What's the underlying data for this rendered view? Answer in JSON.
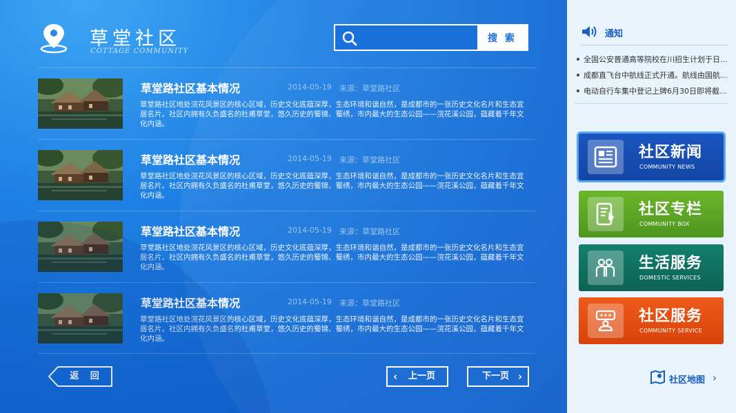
{
  "app": {
    "title": "草堂社区",
    "subtitle": "COTTAGE COMMUNITY"
  },
  "search": {
    "placeholder": "",
    "button_label": "搜 索"
  },
  "articles": [
    {
      "title": "草堂路社区基本情况",
      "date": "2014-05-19",
      "source": "来源：草堂路社区",
      "desc": "草堂路社区地处浣花风景区的核心区域，历史文化底蕴深厚，生态环境和谐自然，是成都市的一张历史文化名片和生态宜居名片。社区内拥有久负盛名的杜甫草堂，悠久历史的蜀锦、蜀绣，市内最大的生态公园——浣花溪公园，蕴藏着千年文化内涵。"
    },
    {
      "title": "草堂路社区基本情况",
      "date": "2014-05-19",
      "source": "来源：草堂路社区",
      "desc": "草堂路社区地处浣花风景区的核心区域，历史文化底蕴深厚，生态环境和谐自然，是成都市的一张历史文化名片和生态宜居名片。社区内拥有久负盛名的杜甫草堂，悠久历史的蜀锦、蜀绣，市内最大的生态公园——浣花溪公园，蕴藏着千年文化内涵。"
    },
    {
      "title": "草堂路社区基本情况",
      "date": "2014-05-19",
      "source": "来源：草堂路社区",
      "desc": "草堂路社区地处浣花风景区的核心区域，历史文化底蕴深厚，生态环境和谐自然，是成都市的一张历史文化名片和生态宜居名片。社区内拥有久负盛名的杜甫草堂，悠久历史的蜀锦、蜀绣，市内最大的生态公园——浣花溪公园，蕴藏着千年文化内涵。"
    },
    {
      "title": "草堂路社区基本情况",
      "date": "2014-05-19",
      "source": "来源：草堂路社区",
      "desc": "草堂路社区地处浣花风景区的核心区域，历史文化底蕴深厚，生态环境和谐自然，是成都市的一张历史文化名片和生态宜居名片。社区内拥有久负盛名的杜甫草堂，悠久历史的蜀锦、蜀绣，市内最大的生态公园——浣花溪公园，蕴藏着千年文化内涵。"
    }
  ],
  "pager": {
    "back_label": "返 回",
    "prev_label": "上一页",
    "next_label": "下一页"
  },
  "notice": {
    "title": "通知",
    "items": [
      "全国公安普通高等院校在川招生计划于日...",
      "成都直飞台中航线正式开通。航线由国航...",
      "电动自行车集中登记上牌6月30日即将截..."
    ]
  },
  "tiles": [
    {
      "title": "社区新闻",
      "subtitle": "COMMUNITY NEWS",
      "icon": "newspaper-icon",
      "color": "#1a56bf"
    },
    {
      "title": "社区专栏",
      "subtitle": "COMMUNITY BOX",
      "icon": "document-edit-icon",
      "color": "#5fa626"
    },
    {
      "title": "生活服务",
      "subtitle": "DOMESTIC SERVICES",
      "icon": "people-group-icon",
      "color": "#10715f"
    },
    {
      "title": "社区服务",
      "subtitle": "COMMUNITY SERVICE",
      "icon": "service-desk-icon",
      "color": "#e44f12"
    }
  ],
  "map_link": {
    "label": "社区地图"
  }
}
